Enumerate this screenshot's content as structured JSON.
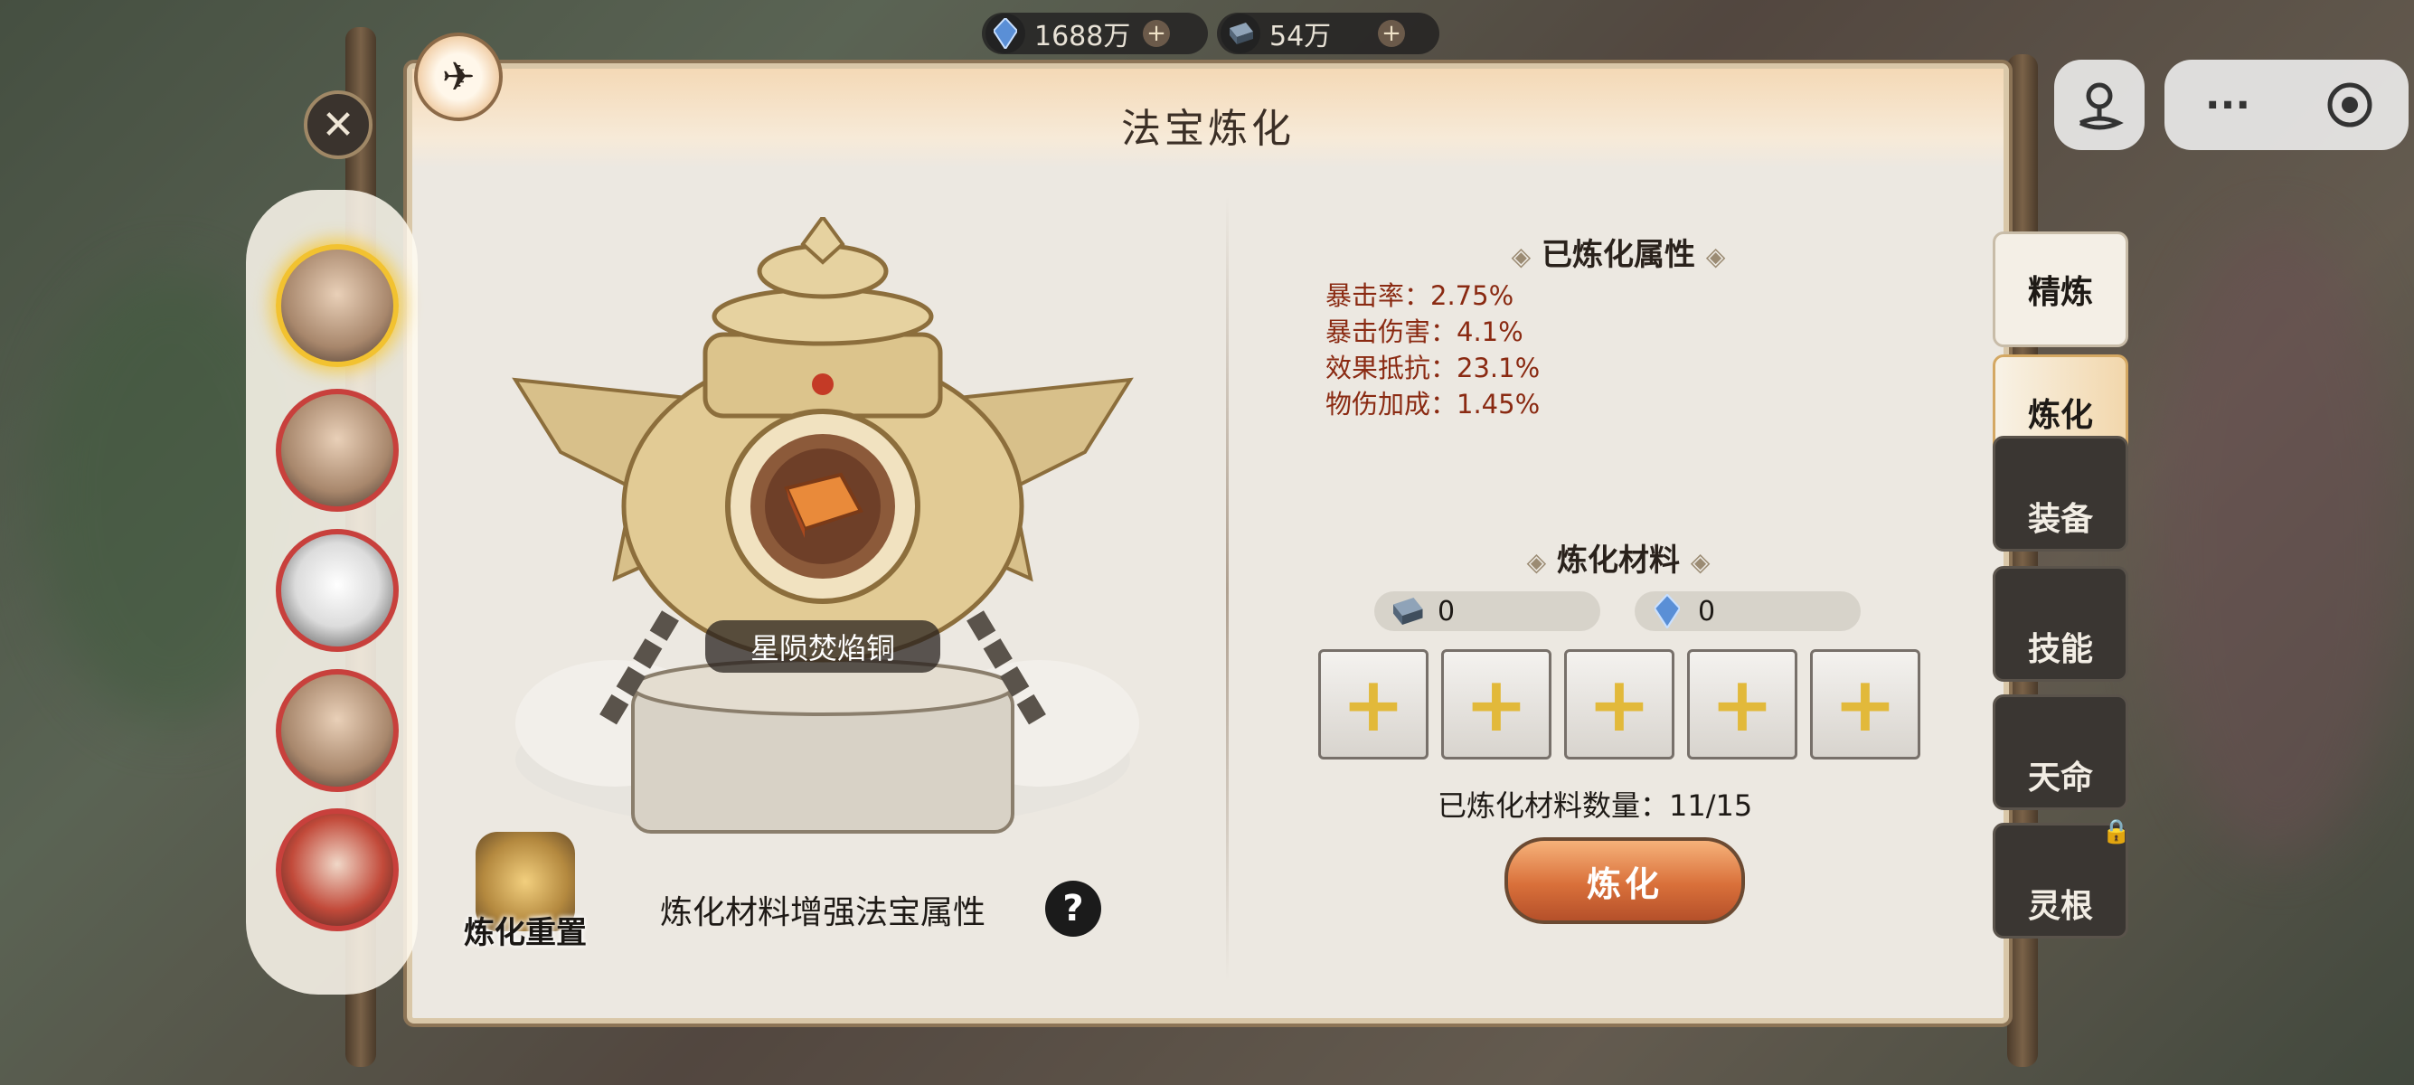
{
  "currency": {
    "spirit_stone": {
      "value": "1688万",
      "icon": "blue-crystal-icon"
    },
    "refine_iron": {
      "value": "54万",
      "icon": "iron-ingot-icon"
    }
  },
  "system": {
    "more_label": "···"
  },
  "panel": {
    "title": "法宝炼化"
  },
  "treasure": {
    "name": "星陨焚焰铜"
  },
  "left": {
    "reset_label": "炼化重置",
    "hint": "炼化材料增强法宝属性",
    "help_label": "?"
  },
  "refined_attrs": {
    "title": "已炼化属性",
    "items": [
      {
        "name": "暴击率：",
        "value": "2.75%"
      },
      {
        "name": "暴击伤害：",
        "value": "4.1%"
      },
      {
        "name": "效果抵抗：",
        "value": "23.1%"
      },
      {
        "name": "物伤加成：",
        "value": "1.45%"
      }
    ]
  },
  "materials": {
    "title": "炼化材料",
    "iron_count": "0",
    "crystal_count": "0",
    "slot_symbol": "+",
    "progress_label": "已炼化材料数量：",
    "progress_value": "11/15",
    "refined_count": 11,
    "max_count": 15,
    "refine_button": "炼化"
  },
  "tabs": [
    {
      "label": "精炼",
      "state": "light"
    },
    {
      "label": "炼化",
      "state": "active"
    },
    {
      "label": "装备",
      "state": "dark"
    },
    {
      "label": "技能",
      "state": "dark"
    },
    {
      "label": "天命",
      "state": "dark"
    },
    {
      "label": "灵根",
      "state": "locked"
    }
  ],
  "colors": {
    "accent_orange": "#d9703a",
    "attr_text": "#8a2a12",
    "selected_ring": "#f2c230",
    "unselected_ring": "#c8403c"
  }
}
